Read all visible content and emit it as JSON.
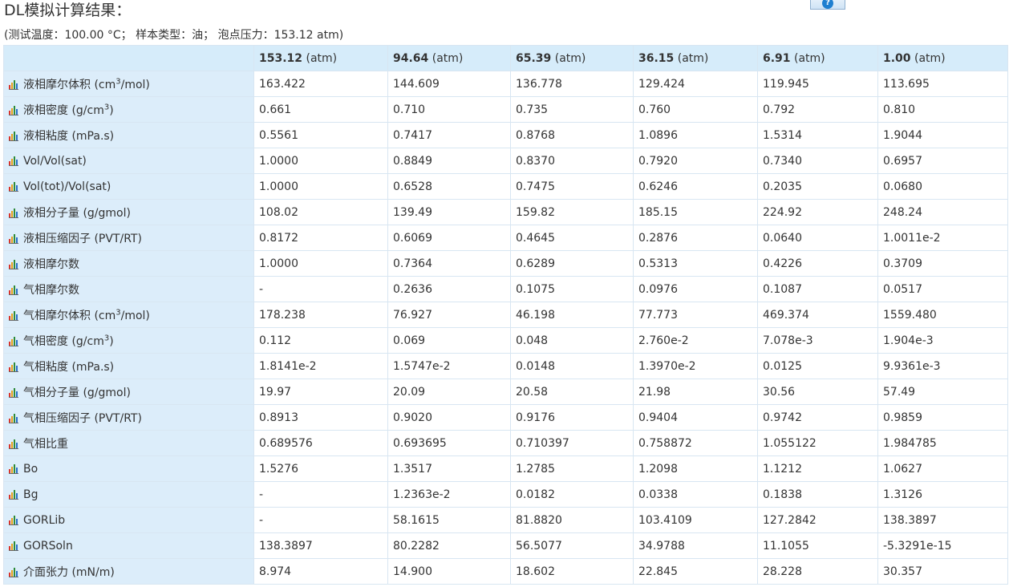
{
  "title": "DL模拟计算结果：",
  "subtitle": "(测试温度：100.00 °C； 样本类型：油； 泡点压力：153.12 atm)",
  "help_icon": "question-mark-icon",
  "table": {
    "unit": "(atm)",
    "pressures": [
      "153.12",
      "94.64",
      "65.39",
      "36.15",
      "6.91",
      "1.00"
    ],
    "rows": [
      {
        "label": "液相摩尔体积 (cm",
        "sup": "3",
        "suffix": "/mol)",
        "values": [
          "163.422",
          "144.609",
          "136.778",
          "129.424",
          "119.945",
          "113.695"
        ]
      },
      {
        "label": "液相密度 (g/cm",
        "sup": "3",
        "suffix": ")",
        "values": [
          "0.661",
          "0.710",
          "0.735",
          "0.760",
          "0.792",
          "0.810"
        ]
      },
      {
        "label": "液相粘度 (mPa.s)",
        "values": [
          "0.5561",
          "0.7417",
          "0.8768",
          "1.0896",
          "1.5314",
          "1.9044"
        ]
      },
      {
        "label": "Vol/Vol(sat)",
        "values": [
          "1.0000",
          "0.8849",
          "0.8370",
          "0.7920",
          "0.7340",
          "0.6957"
        ]
      },
      {
        "label": "Vol(tot)/Vol(sat)",
        "values": [
          "1.0000",
          "0.6528",
          "0.7475",
          "0.6246",
          "0.2035",
          "0.0680"
        ]
      },
      {
        "label": "液相分子量 (g/gmol)",
        "values": [
          "108.02",
          "139.49",
          "159.82",
          "185.15",
          "224.92",
          "248.24"
        ]
      },
      {
        "label": "液相压缩因子 (PVT/RT)",
        "values": [
          "0.8172",
          "0.6069",
          "0.4645",
          "0.2876",
          "0.0640",
          "1.0011e-2"
        ]
      },
      {
        "label": "液相摩尔数",
        "values": [
          "1.0000",
          "0.7364",
          "0.6289",
          "0.5313",
          "0.4226",
          "0.3709"
        ]
      },
      {
        "label": "气相摩尔数",
        "values": [
          "-",
          "0.2636",
          "0.1075",
          "0.0976",
          "0.1087",
          "0.0517"
        ]
      },
      {
        "label": "气相摩尔体积 (cm",
        "sup": "3",
        "suffix": "/mol)",
        "values": [
          "178.238",
          "76.927",
          "46.198",
          "77.773",
          "469.374",
          "1559.480"
        ]
      },
      {
        "label": "气相密度 (g/cm",
        "sup": "3",
        "suffix": ")",
        "values": [
          "0.112",
          "0.069",
          "0.048",
          "2.760e-2",
          "7.078e-3",
          "1.904e-3"
        ]
      },
      {
        "label": "气相粘度 (mPa.s)",
        "values": [
          "1.8141e-2",
          "1.5747e-2",
          "0.0148",
          "1.3970e-2",
          "0.0125",
          "9.9361e-3"
        ]
      },
      {
        "label": "气相分子量 (g/gmol)",
        "values": [
          "19.97",
          "20.09",
          "20.58",
          "21.98",
          "30.56",
          "57.49"
        ]
      },
      {
        "label": "气相压缩因子 (PVT/RT)",
        "values": [
          "0.8913",
          "0.9020",
          "0.9176",
          "0.9404",
          "0.9742",
          "0.9859"
        ]
      },
      {
        "label": "气相比重",
        "values": [
          "0.689576",
          "0.693695",
          "0.710397",
          "0.758872",
          "1.055122",
          "1.984785"
        ]
      },
      {
        "label": "Bo",
        "values": [
          "1.5276",
          "1.3517",
          "1.2785",
          "1.2098",
          "1.1212",
          "1.0627"
        ]
      },
      {
        "label": "Bg",
        "values": [
          "-",
          "1.2363e-2",
          "0.0182",
          "0.0338",
          "0.1838",
          "1.3126"
        ]
      },
      {
        "label": "GORLib",
        "values": [
          "-",
          "58.1615",
          "81.8820",
          "103.4109",
          "127.2842",
          "138.3897"
        ]
      },
      {
        "label": "GORSoln",
        "values": [
          "138.3897",
          "80.2282",
          "56.5077",
          "34.9788",
          "11.1055",
          "-5.3291e-15"
        ]
      },
      {
        "label": "介面张力 (mN/m)",
        "values": [
          "8.974",
          "14.900",
          "18.602",
          "22.845",
          "28.228",
          "30.357"
        ]
      }
    ]
  }
}
